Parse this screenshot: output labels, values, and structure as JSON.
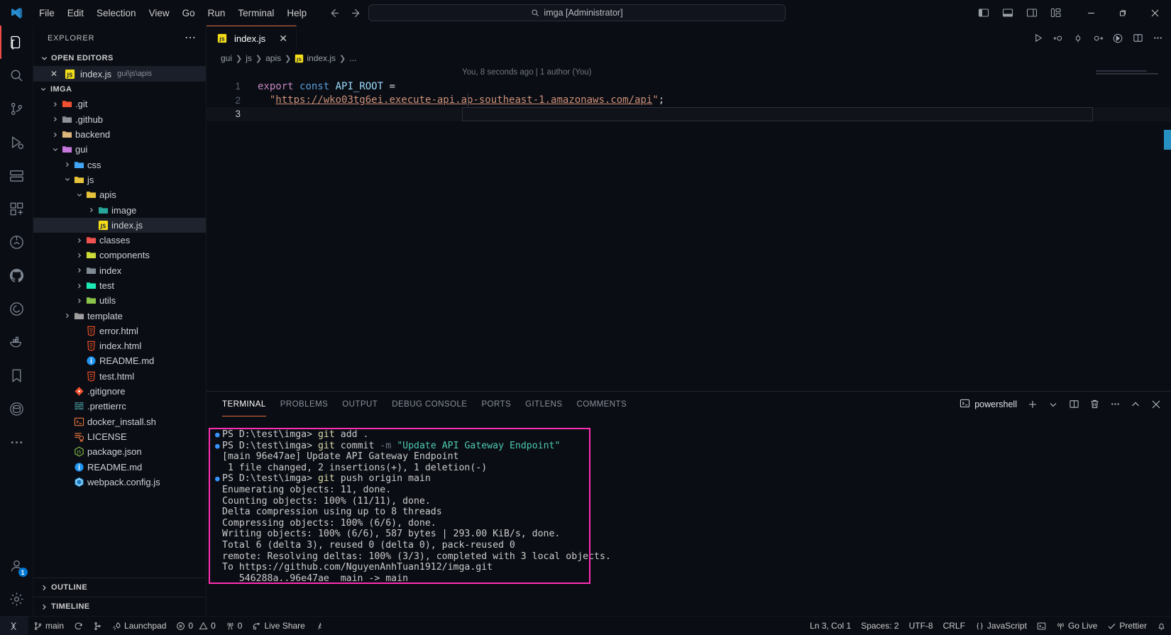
{
  "titlebar": {
    "menus": [
      "File",
      "Edit",
      "Selection",
      "View",
      "Go",
      "Run",
      "Terminal",
      "Help"
    ],
    "command_center_text": "imga [Administrator]",
    "back_icon": "arrow-left-icon",
    "forward_icon": "arrow-right-icon",
    "layout_buttons": [
      "toggle-primary-sidebar-icon",
      "toggle-panel-icon",
      "toggle-secondary-sidebar-icon",
      "customize-layout-icon"
    ],
    "window_controls": [
      "minimize-icon",
      "maximize-icon",
      "close-icon"
    ]
  },
  "activitybar": {
    "items": [
      {
        "name": "explorer",
        "icon": "files-icon",
        "active": true
      },
      {
        "name": "search",
        "icon": "search-icon",
        "active": false
      },
      {
        "name": "source-control",
        "icon": "source-control-icon",
        "active": false
      },
      {
        "name": "run-and-debug",
        "icon": "debug-icon",
        "active": false
      },
      {
        "name": "remote-explorer",
        "icon": "remote-explorer-icon",
        "active": false
      },
      {
        "name": "extensions",
        "icon": "extensions-icon",
        "active": false
      },
      {
        "name": "testing",
        "icon": "beaker-icon",
        "active": false
      },
      {
        "name": "github",
        "icon": "github-icon",
        "active": false
      },
      {
        "name": "gitlens",
        "icon": "gitlens-icon",
        "active": false
      },
      {
        "name": "docker",
        "icon": "docker-icon",
        "active": false
      },
      {
        "name": "bookmarks",
        "icon": "bookmark-icon",
        "active": false
      },
      {
        "name": "database",
        "icon": "database-icon",
        "active": false
      },
      {
        "name": "more-views",
        "icon": "ellipsis-icon",
        "active": false
      }
    ],
    "accounts": {
      "icon": "account-icon",
      "badge": "1"
    },
    "settings": {
      "icon": "gear-icon"
    }
  },
  "sidebar": {
    "title": "EXPLORER",
    "more_icon": "ellipsis-icon",
    "open_editors": {
      "label": "OPEN EDITORS",
      "items": [
        {
          "name": "index.js",
          "description": "gui\\js\\apis",
          "icon": "js-file-icon",
          "close_icon": "close-icon"
        }
      ]
    },
    "workspace": {
      "label": "IMGA",
      "tree": [
        {
          "label": ".git",
          "indent": 1,
          "type": "folder",
          "icon": "git-folder-icon",
          "twisty": "collapsed"
        },
        {
          "label": ".github",
          "indent": 1,
          "type": "folder",
          "icon": "github-folder-icon",
          "twisty": "collapsed"
        },
        {
          "label": "backend",
          "indent": 1,
          "type": "folder",
          "icon": "folder-icon",
          "twisty": "collapsed"
        },
        {
          "label": "gui",
          "indent": 1,
          "type": "folder",
          "icon": "gui-folder-icon",
          "twisty": "expanded"
        },
        {
          "label": "css",
          "indent": 2,
          "type": "folder",
          "icon": "css-folder-icon",
          "twisty": "collapsed"
        },
        {
          "label": "js",
          "indent": 2,
          "type": "folder",
          "icon": "js-folder-icon",
          "twisty": "expanded"
        },
        {
          "label": "apis",
          "indent": 3,
          "type": "folder",
          "icon": "api-folder-icon",
          "twisty": "expanded"
        },
        {
          "label": "image",
          "indent": 4,
          "type": "folder",
          "icon": "image-folder-icon",
          "twisty": "collapsed"
        },
        {
          "label": "index.js",
          "indent": 4,
          "type": "file",
          "icon": "js-file-icon",
          "twisty": "none",
          "selected": true
        },
        {
          "label": "classes",
          "indent": 3,
          "type": "folder",
          "icon": "class-folder-icon",
          "twisty": "collapsed"
        },
        {
          "label": "components",
          "indent": 3,
          "type": "folder",
          "icon": "components-folder-icon",
          "twisty": "collapsed"
        },
        {
          "label": "index",
          "indent": 3,
          "type": "folder",
          "icon": "folder-plain-icon",
          "twisty": "collapsed"
        },
        {
          "label": "test",
          "indent": 3,
          "type": "folder",
          "icon": "test-folder-icon",
          "twisty": "collapsed"
        },
        {
          "label": "utils",
          "indent": 3,
          "type": "folder",
          "icon": "utils-folder-icon",
          "twisty": "collapsed"
        },
        {
          "label": "template",
          "indent": 2,
          "type": "folder",
          "icon": "template-folder-icon",
          "twisty": "collapsed"
        },
        {
          "label": "error.html",
          "indent": 3,
          "type": "file",
          "icon": "html-file-icon",
          "twisty": "none"
        },
        {
          "label": "index.html",
          "indent": 3,
          "type": "file",
          "icon": "html-file-icon",
          "twisty": "none"
        },
        {
          "label": "README.md",
          "indent": 3,
          "type": "file",
          "icon": "markdown-file-icon",
          "twisty": "none"
        },
        {
          "label": "test.html",
          "indent": 3,
          "type": "file",
          "icon": "html-file-icon",
          "twisty": "none"
        },
        {
          "label": ".gitignore",
          "indent": 2,
          "type": "file",
          "icon": "gitignore-file-icon",
          "twisty": "none"
        },
        {
          "label": ".prettierrc",
          "indent": 2,
          "type": "file",
          "icon": "prettier-file-icon",
          "twisty": "none"
        },
        {
          "label": "docker_install.sh",
          "indent": 2,
          "type": "file",
          "icon": "shell-file-icon",
          "twisty": "none"
        },
        {
          "label": "LICENSE",
          "indent": 2,
          "type": "file",
          "icon": "license-file-icon",
          "twisty": "none"
        },
        {
          "label": "package.json",
          "indent": 2,
          "type": "file",
          "icon": "npm-file-icon",
          "twisty": "none"
        },
        {
          "label": "README.md",
          "indent": 2,
          "type": "file",
          "icon": "markdown-file-icon",
          "twisty": "none"
        },
        {
          "label": "webpack.config.js",
          "indent": 2,
          "type": "file",
          "icon": "webpack-file-icon",
          "twisty": "none"
        }
      ]
    },
    "bottom_sections": [
      {
        "label": "OUTLINE"
      },
      {
        "label": "TIMELINE"
      }
    ]
  },
  "editor": {
    "tabs": [
      {
        "label": "index.js",
        "icon": "js-file-icon",
        "close_icon": "close-icon",
        "active": true
      }
    ],
    "actions": [
      "run-icon",
      "step-back-icon",
      "step-icon",
      "step-forward-icon",
      "run-with-clock-icon",
      "split-editor-icon",
      "ellipsis-icon"
    ],
    "breadcrumb": [
      "gui",
      "js",
      "apis",
      "index.js",
      "..."
    ],
    "blame": "You, 8 seconds ago | 1 author (You)",
    "lines": [
      {
        "number": "1",
        "tokens": [
          {
            "t": "export",
            "c": "kw"
          },
          {
            "t": " ",
            "c": "plain"
          },
          {
            "t": "const",
            "c": "kw2"
          },
          {
            "t": " ",
            "c": "plain"
          },
          {
            "t": "API_ROOT",
            "c": "var"
          },
          {
            "t": " ",
            "c": "plain"
          },
          {
            "t": "=",
            "c": "op"
          }
        ]
      },
      {
        "number": "2",
        "tokens": [
          {
            "t": "  ",
            "c": "plain"
          },
          {
            "t": "\"",
            "c": "str"
          },
          {
            "t": "https://wko03tg6ei.execute-api.ap-southeast-1.amazonaws.com/api",
            "c": "str-link"
          },
          {
            "t": "\"",
            "c": "str"
          },
          {
            "t": ";",
            "c": "op"
          }
        ]
      },
      {
        "number": "3",
        "tokens": []
      }
    ]
  },
  "panel": {
    "tabs": [
      "TERMINAL",
      "PROBLEMS",
      "OUTPUT",
      "DEBUG CONSOLE",
      "PORTS",
      "GITLENS",
      "COMMENTS"
    ],
    "active_tab": "TERMINAL",
    "shell_name": "powershell",
    "shell_icon": "terminal-powershell-icon",
    "actions": [
      "new-terminal-icon",
      "chevron-down-icon",
      "split-terminal-icon",
      "kill-terminal-icon",
      "ellipsis-icon",
      "chevron-up-icon",
      "close-icon"
    ],
    "highlight_color": "#ff2fb3",
    "terminal_lines": [
      {
        "prompt": true,
        "segments": [
          {
            "t": "PS D:\\test\\imga> ",
            "c": "plain"
          },
          {
            "t": "git",
            "c": "cmd"
          },
          {
            "t": " add .",
            "c": "plain"
          }
        ]
      },
      {
        "prompt": true,
        "segments": [
          {
            "t": "PS D:\\test\\imga> ",
            "c": "plain"
          },
          {
            "t": "git",
            "c": "cmd"
          },
          {
            "t": " commit ",
            "c": "plain"
          },
          {
            "t": "-m",
            "c": "flag"
          },
          {
            "t": " ",
            "c": "plain"
          },
          {
            "t": "\"Update API Gateway Endpoint\"",
            "c": "str"
          }
        ]
      },
      {
        "prompt": false,
        "segments": [
          {
            "t": "[main 96e47ae] Update API Gateway Endpoint",
            "c": "plain"
          }
        ]
      },
      {
        "prompt": false,
        "segments": [
          {
            "t": " 1 file changed, 2 insertions(+), 1 deletion(-)",
            "c": "plain"
          }
        ]
      },
      {
        "prompt": true,
        "segments": [
          {
            "t": "PS D:\\test\\imga> ",
            "c": "plain"
          },
          {
            "t": "git",
            "c": "cmd"
          },
          {
            "t": " push origin main",
            "c": "plain"
          }
        ]
      },
      {
        "prompt": false,
        "segments": [
          {
            "t": "Enumerating objects: 11, done.",
            "c": "plain"
          }
        ]
      },
      {
        "prompt": false,
        "segments": [
          {
            "t": "Counting objects: 100% (11/11), done.",
            "c": "plain"
          }
        ]
      },
      {
        "prompt": false,
        "segments": [
          {
            "t": "Delta compression using up to 8 threads",
            "c": "plain"
          }
        ]
      },
      {
        "prompt": false,
        "segments": [
          {
            "t": "Compressing objects: 100% (6/6), done.",
            "c": "plain"
          }
        ]
      },
      {
        "prompt": false,
        "segments": [
          {
            "t": "Writing objects: 100% (6/6), 587 bytes | 293.00 KiB/s, done.",
            "c": "plain"
          }
        ]
      },
      {
        "prompt": false,
        "segments": [
          {
            "t": "Total 6 (delta 3), reused 0 (delta 0), pack-reused 0",
            "c": "plain"
          }
        ]
      },
      {
        "prompt": false,
        "segments": [
          {
            "t": "remote: Resolving deltas: 100% (3/3), completed with 3 local objects.",
            "c": "plain"
          }
        ]
      },
      {
        "prompt": false,
        "segments": [
          {
            "t": "To https://github.com/NguyenAnhTuan1912/imga.git",
            "c": "plain"
          }
        ]
      },
      {
        "prompt": false,
        "segments": [
          {
            "t": "   546288a..96e47ae  main -> main",
            "c": "plain"
          }
        ]
      }
    ]
  },
  "statusbar": {
    "remote_icon": "remote-window-icon",
    "left": [
      {
        "name": "branch",
        "icon": "source-control-icon",
        "label": "main"
      },
      {
        "name": "sync",
        "icon": "sync-icon",
        "label": ""
      },
      {
        "name": "git-graph",
        "icon": "git-graph-icon",
        "label": ""
      },
      {
        "name": "launchpad",
        "icon": "rocket-icon",
        "label": "Launchpad"
      },
      {
        "name": "problems",
        "icon": "error-warning-icon",
        "label": "0  0"
      },
      {
        "name": "ports",
        "icon": "radio-tower-icon",
        "label": "0"
      },
      {
        "name": "live-share",
        "icon": "live-share-icon",
        "label": "Live Share"
      },
      {
        "name": "gitlens-blame",
        "icon": "gitlens-icon",
        "label": ""
      }
    ],
    "right": [
      {
        "name": "cursor-position",
        "label": "Ln 3, Col 1"
      },
      {
        "name": "indentation",
        "label": "Spaces: 2"
      },
      {
        "name": "encoding",
        "label": "UTF-8"
      },
      {
        "name": "eol",
        "label": "CRLF"
      },
      {
        "name": "language-mode",
        "icon": "braces-icon",
        "label": "JavaScript"
      },
      {
        "name": "terminal-toggle",
        "icon": "terminal-icon",
        "label": ""
      },
      {
        "name": "go-live",
        "icon": "broadcast-icon",
        "label": "Go Live"
      },
      {
        "name": "prettier",
        "icon": "check-icon",
        "label": "Prettier"
      },
      {
        "name": "notifications",
        "icon": "bell-icon",
        "label": ""
      }
    ]
  }
}
